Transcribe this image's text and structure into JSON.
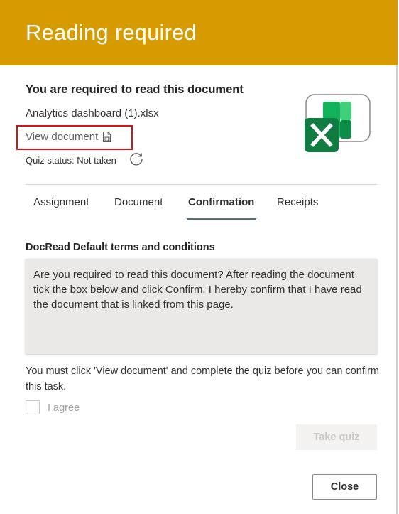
{
  "header": {
    "title": "Reading required"
  },
  "document": {
    "heading": "You are required to read this document",
    "file_name": "Analytics dashboard (1).xlsx",
    "view_link": "View document",
    "quiz_status": "Quiz status: Not taken",
    "file_icon": "excel-icon"
  },
  "tabs": [
    {
      "label": "Assignment",
      "active": false
    },
    {
      "label": "Document",
      "active": false
    },
    {
      "label": "Confirmation",
      "active": true
    },
    {
      "label": "Receipts",
      "active": false
    }
  ],
  "terms": {
    "heading": "DocRead Default terms and conditions",
    "body": "Are you required to read this document? After reading the document tick the box below and click Confirm. I hereby confirm that I have read the document that is linked from this page."
  },
  "notice": "You must click 'View document' and complete the quiz before you can confirm this task.",
  "agree": {
    "label": "I agree",
    "checked": false,
    "disabled": true
  },
  "buttons": {
    "take_quiz": "Take quiz",
    "close": "Close"
  },
  "colors": {
    "header": "#d69b00",
    "highlight_border": "#e01010",
    "active_tab_underline": "#5d6d78"
  }
}
